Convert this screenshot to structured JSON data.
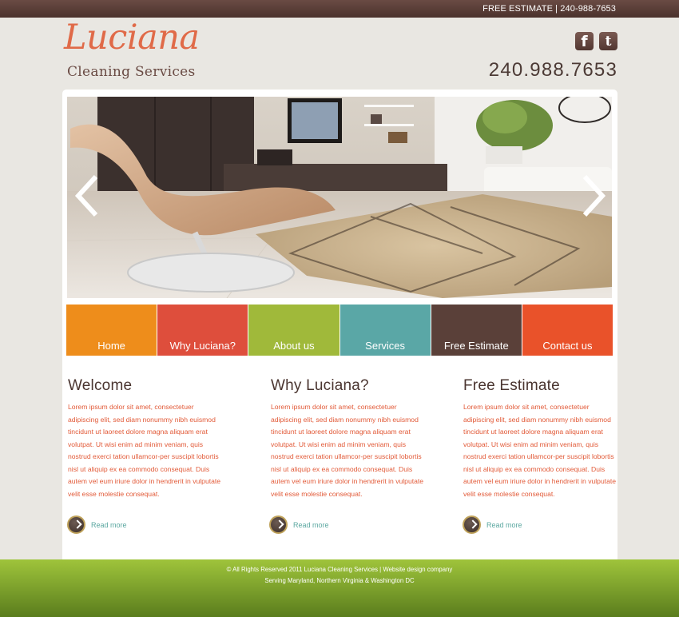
{
  "topbar": {
    "text": "FREE ESTIMATE  |  240-988-7653"
  },
  "logo": {
    "script": "Luciana",
    "subtitle": "Cleaning Services"
  },
  "social": {
    "facebook_glyph": "f",
    "twitter_glyph": "t"
  },
  "phone": "240.988.7653",
  "nav": {
    "items": [
      {
        "label": "Home",
        "color": "#ee8d1b"
      },
      {
        "label": "Why Luciana?",
        "color": "#de4e3c"
      },
      {
        "label": "About us",
        "color": "#a0b93a"
      },
      {
        "label": "Services",
        "color": "#5aa7a6"
      },
      {
        "label": "Free Estimate",
        "color": "#5a4039"
      },
      {
        "label": "Contact us",
        "color": "#e9522a"
      }
    ]
  },
  "columns": [
    {
      "title": "Welcome",
      "body": "Lorem ipsum dolor sit amet, consectetuer adipiscing elit, sed diam nonummy nibh euismod tincidunt ut laoreet dolore magna aliquam erat volutpat. Ut wisi enim ad minim veniam, quis nostrud exerci tation ullamcor-per suscipit lobortis nisl ut aliquip ex ea commodo consequat. Duis autem vel eum iriure dolor in hendrerit in vulputate velit esse molestie consequat.",
      "readmore": "Read more"
    },
    {
      "title": "Why Luciana?",
      "body": "Lorem ipsum dolor sit amet, consectetuer adipiscing elit, sed diam nonummy nibh euismod tincidunt ut laoreet dolore magna aliquam erat volutpat. Ut wisi enim ad minim veniam, quis nostrud exerci tation ullamcor-per suscipit lobortis nisl ut aliquip ex ea commodo consequat. Duis autem vel eum iriure dolor in hendrerit in vulputate velit esse molestie consequat.",
      "readmore": "Read more"
    },
    {
      "title": "Free Estimate",
      "body": "Lorem ipsum dolor sit amet, consectetuer adipiscing elit, sed diam nonummy nibh euismod tincidunt ut laoreet dolore magna aliquam erat volutpat. Ut wisi enim ad minim veniam, quis nostrud exerci tation ullamcor-per suscipit lobortis nisl ut aliquip ex ea commodo consequat. Duis autem vel eum iriure dolor in hendrerit in vulputate velit esse molestie consequat.",
      "readmore": "Read more"
    }
  ],
  "footer": {
    "line1": "© All Rights Reserved 2011 Luciana Cleaning Services  |  Website design company",
    "line2": "Serving Maryland, Northern Virginia & Washington DC"
  },
  "icons": [
    "facebook-icon",
    "twitter-icon",
    "arrow-left-icon",
    "arrow-right-icon",
    "read-more-arrow-icon"
  ],
  "colors": {
    "accent": "#e06a48",
    "brown": "#5a4039",
    "teal": "#5aa7a0",
    "green": "#9fc43b"
  }
}
